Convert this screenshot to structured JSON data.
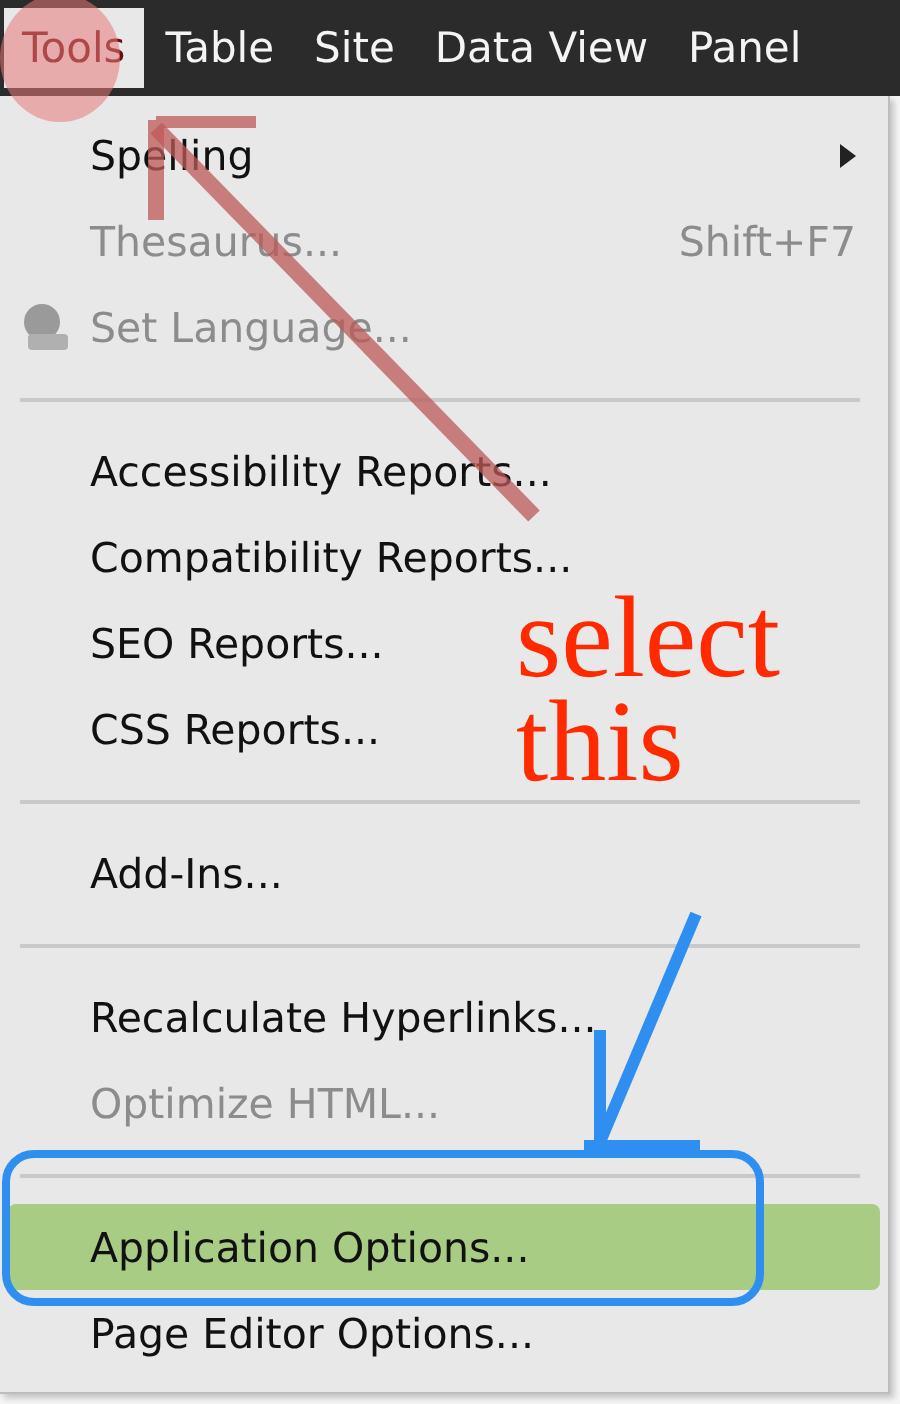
{
  "menubar": [
    {
      "label": "Tools",
      "selected": true
    },
    {
      "label": "Table",
      "selected": false
    },
    {
      "label": "Site",
      "selected": false
    },
    {
      "label": "Data View",
      "selected": false
    },
    {
      "label": "Panel",
      "selected": false
    }
  ],
  "menu": [
    {
      "kind": "item",
      "label": "Spelling",
      "submenu": true,
      "disabled": false,
      "selected": false
    },
    {
      "kind": "item",
      "label": "Thesaurus...",
      "shortcut": "Shift+F7",
      "disabled": true,
      "selected": false
    },
    {
      "kind": "item",
      "label": "Set Language...",
      "icon": true,
      "disabled": true,
      "selected": false
    },
    {
      "kind": "separator"
    },
    {
      "kind": "item",
      "label": "Accessibility Reports...",
      "disabled": false,
      "selected": false
    },
    {
      "kind": "item",
      "label": "Compatibility Reports...",
      "disabled": false,
      "selected": false
    },
    {
      "kind": "item",
      "label": "SEO Reports...",
      "disabled": false,
      "selected": false
    },
    {
      "kind": "item",
      "label": "CSS Reports...",
      "disabled": false,
      "selected": false
    },
    {
      "kind": "separator"
    },
    {
      "kind": "item",
      "label": "Add-Ins...",
      "disabled": false,
      "selected": false
    },
    {
      "kind": "separator"
    },
    {
      "kind": "item",
      "label": "Recalculate Hyperlinks...",
      "disabled": false,
      "selected": false
    },
    {
      "kind": "item",
      "label": "Optimize HTML...",
      "disabled": true,
      "selected": false
    },
    {
      "kind": "separator"
    },
    {
      "kind": "item",
      "label": "Application Options...",
      "disabled": false,
      "selected": true
    },
    {
      "kind": "item",
      "label": "Page Editor Options...",
      "disabled": false,
      "selected": false
    }
  ],
  "annotation": {
    "lines": [
      "select",
      "this"
    ]
  }
}
